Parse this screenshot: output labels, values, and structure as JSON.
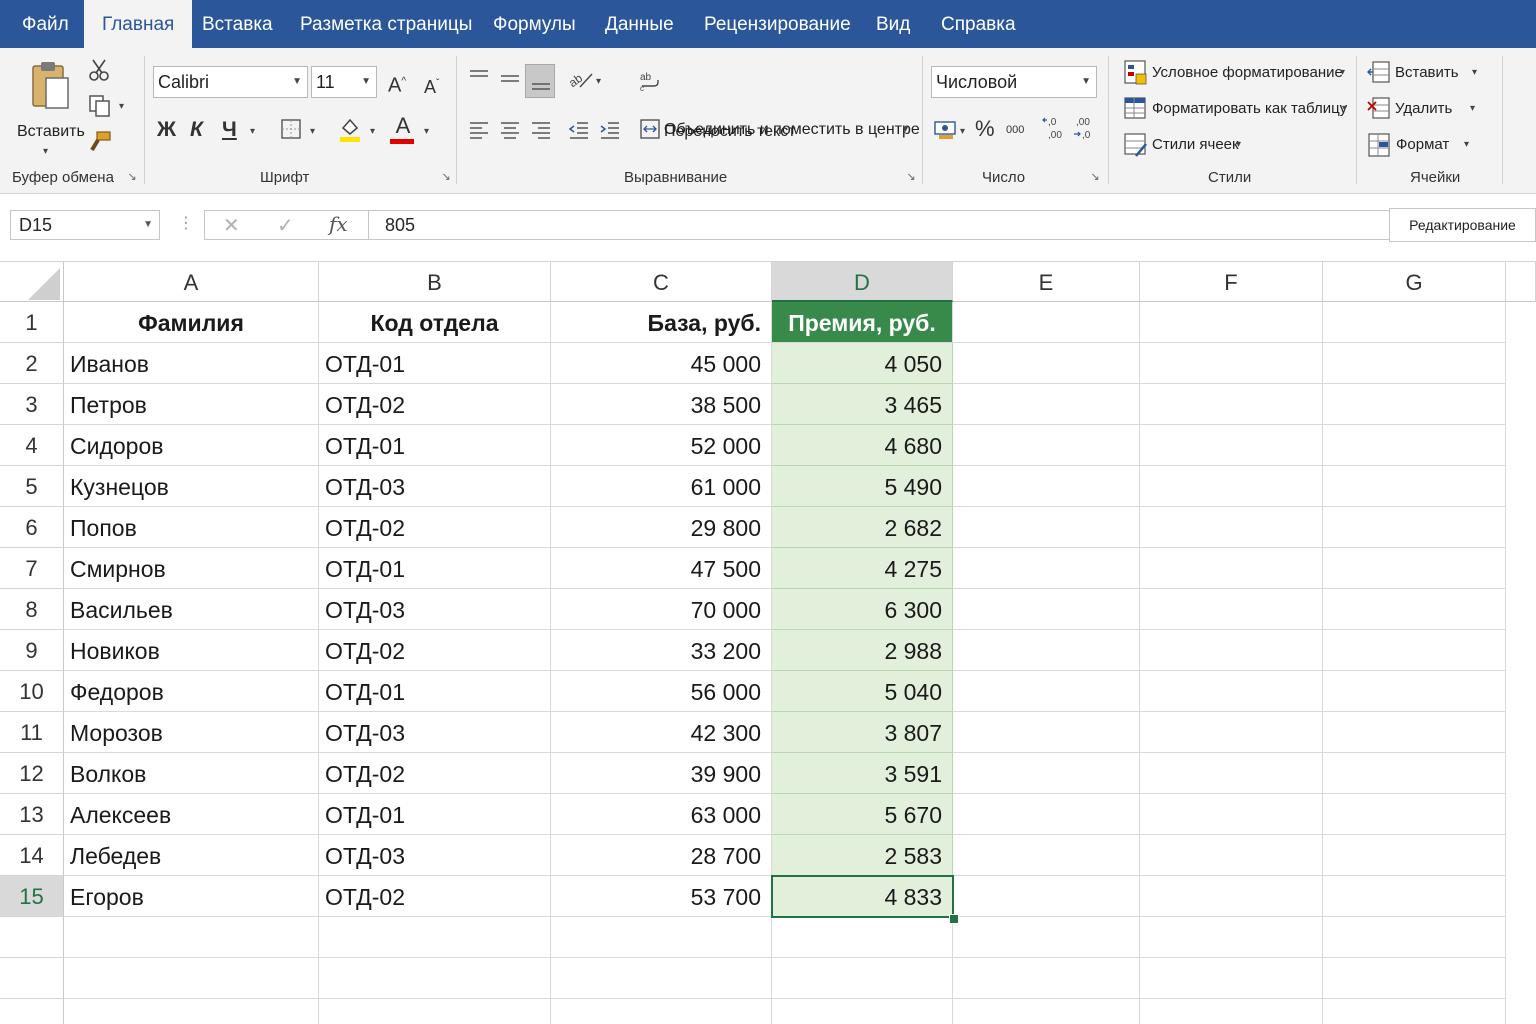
{
  "tabs": [
    "Файл",
    "Главная",
    "Вставка",
    "Разметка страницы",
    "Формулы",
    "Данные",
    "Рецензирование",
    "Вид",
    "Справка"
  ],
  "active_tab_index": 1,
  "ribbon": {
    "clipboard": {
      "paste_label": "Вставить",
      "group_label": "Буфер обмена"
    },
    "font": {
      "name": "Calibri",
      "size": "11",
      "bold": "Ж",
      "italic": "К",
      "underline": "Ч",
      "grow": "A",
      "shrink": "A",
      "font_color_letter": "A",
      "group_label": "Шрифт"
    },
    "alignment": {
      "wrap_text": "Переносить текст",
      "merge_center": "Объединить и поместить в центре",
      "group_label": "Выравнивание"
    },
    "number": {
      "format": "Числовой",
      "percent": "%",
      "thousands": "000",
      "group_label": "Число"
    },
    "styles": {
      "conditional": "Условное форматирование",
      "as_table": "Форматировать как таблицу",
      "cell_styles": "Стили ячеек",
      "group_label": "Стили"
    },
    "cells": {
      "insert": "Вставить",
      "delete": "Удалить",
      "format": "Формат",
      "group_label": "Ячейки"
    }
  },
  "formula_bar": {
    "name_box": "D15",
    "cancel": "✕",
    "enter": "✓",
    "fx": "fx",
    "value": "805",
    "edit_mode": "Редактирование"
  },
  "columns": [
    "A",
    "B",
    "C",
    "D",
    "E",
    "F",
    "G"
  ],
  "selected_column": "D",
  "selected_row": 15,
  "headers": [
    "Фамилия",
    "Код отдела",
    "База, руб.",
    "Премия, руб."
  ],
  "rows": [
    [
      "Иванов",
      "ОТД-01",
      "45 000",
      "4 050"
    ],
    [
      "Петров",
      "ОТД-02",
      "38 500",
      "3 465"
    ],
    [
      "Сидоров",
      "ОТД-01",
      "52 000",
      "4 680"
    ],
    [
      "Кузнецов",
      "ОТД-03",
      "61 000",
      "5 490"
    ],
    [
      "Попов",
      "ОТД-02",
      "29 800",
      "2 682"
    ],
    [
      "Смирнов",
      "ОТД-01",
      "47 500",
      "4 275"
    ],
    [
      "Васильев",
      "ОТД-03",
      "70 000",
      "6 300"
    ],
    [
      "Новиков",
      "ОТД-02",
      "33 200",
      "2 988"
    ],
    [
      "Федоров",
      "ОТД-01",
      "56 000",
      "5 040"
    ],
    [
      "Морозов",
      "ОТД-03",
      "42 300",
      "3 807"
    ],
    [
      "Волков",
      "ОТД-02",
      "39 900",
      "3 591"
    ],
    [
      "Алексеев",
      "ОТД-01",
      "63 000",
      "5 670"
    ],
    [
      "Лебедев",
      "ОТД-03",
      "28 700",
      "2 583"
    ],
    [
      "Егоров",
      "ОТД-02",
      "53 700",
      "4 833"
    ]
  ],
  "colors": {
    "ribbon_blue": "#2b579a",
    "excel_green": "#217346",
    "header_green": "#378a49",
    "bonus_fill": "#e2efda"
  }
}
